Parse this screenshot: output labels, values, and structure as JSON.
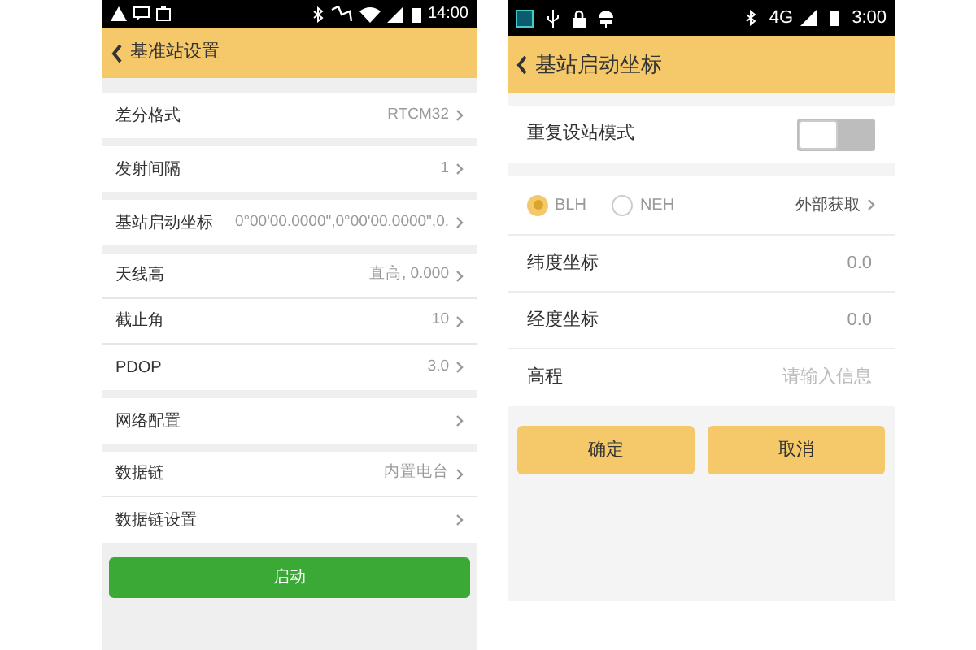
{
  "left_screen": {
    "status_bar": {
      "time": "14:00"
    },
    "header": {
      "title": "基准站设置"
    },
    "groups": [
      [
        {
          "label": "差分格式",
          "value": "RTCM32"
        }
      ],
      [
        {
          "label": "发射间隔",
          "value": "1"
        }
      ],
      [
        {
          "label": "基站启动坐标",
          "value": "0°00'00.0000\",0°00'00.0000\",0."
        }
      ],
      [
        {
          "label": "天线高",
          "value": "直高, 0.000"
        },
        {
          "label": "截止角",
          "value": "10"
        },
        {
          "label": "PDOP",
          "value": "3.0"
        }
      ],
      [
        {
          "label": "网络配置"
        }
      ],
      [
        {
          "label": "数据链",
          "value": "内置电台"
        },
        {
          "label": "数据链设置"
        }
      ]
    ],
    "start_button": "启动"
  },
  "right_screen": {
    "status_bar": {
      "network": "4G",
      "time": "3:00"
    },
    "header": {
      "title": "基站启动坐标"
    },
    "repeat_mode": {
      "label": "重复设站模式",
      "on": false
    },
    "coordinate_types": [
      {
        "label": "BLH",
        "selected": true
      },
      {
        "label": "NEH",
        "selected": false
      }
    ],
    "external_link": "外部获取",
    "fields": [
      {
        "label": "纬度坐标",
        "value": "0.0"
      },
      {
        "label": "经度坐标",
        "value": "0.0"
      },
      {
        "label": "高程",
        "placeholder": "请输入信息"
      }
    ],
    "buttons": [
      "确定",
      "取消"
    ]
  }
}
